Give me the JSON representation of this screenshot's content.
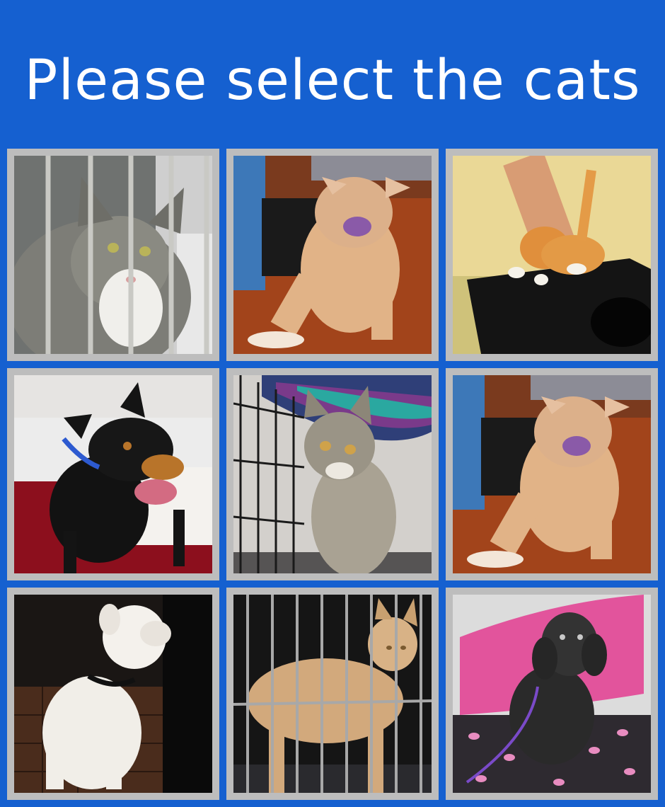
{
  "prompt": {
    "text": "Please select the cats"
  },
  "grid": {
    "tiles": [
      {
        "subject": "cat",
        "description_icon": "tabby-cat-in-cage-photo"
      },
      {
        "subject": "dog",
        "description_icon": "tan-dog-sitting-photo"
      },
      {
        "subject": "cat",
        "description_icon": "orange-cat-on-table-photo"
      },
      {
        "subject": "dog",
        "description_icon": "black-tan-pinscher-photo"
      },
      {
        "subject": "cat",
        "description_icon": "gray-kitten-in-crate-photo"
      },
      {
        "subject": "dog",
        "description_icon": "tan-dog-sitting-photo"
      },
      {
        "subject": "dog",
        "description_icon": "white-boxer-dog-photo"
      },
      {
        "subject": "cat",
        "description_icon": "orange-cat-in-cage-photo"
      },
      {
        "subject": "dog",
        "description_icon": "black-terrier-on-pillow-photo"
      }
    ]
  },
  "colors": {
    "background": "#1560d0",
    "tile_border": "#bdbdbd",
    "title_text": "#ffffff"
  }
}
